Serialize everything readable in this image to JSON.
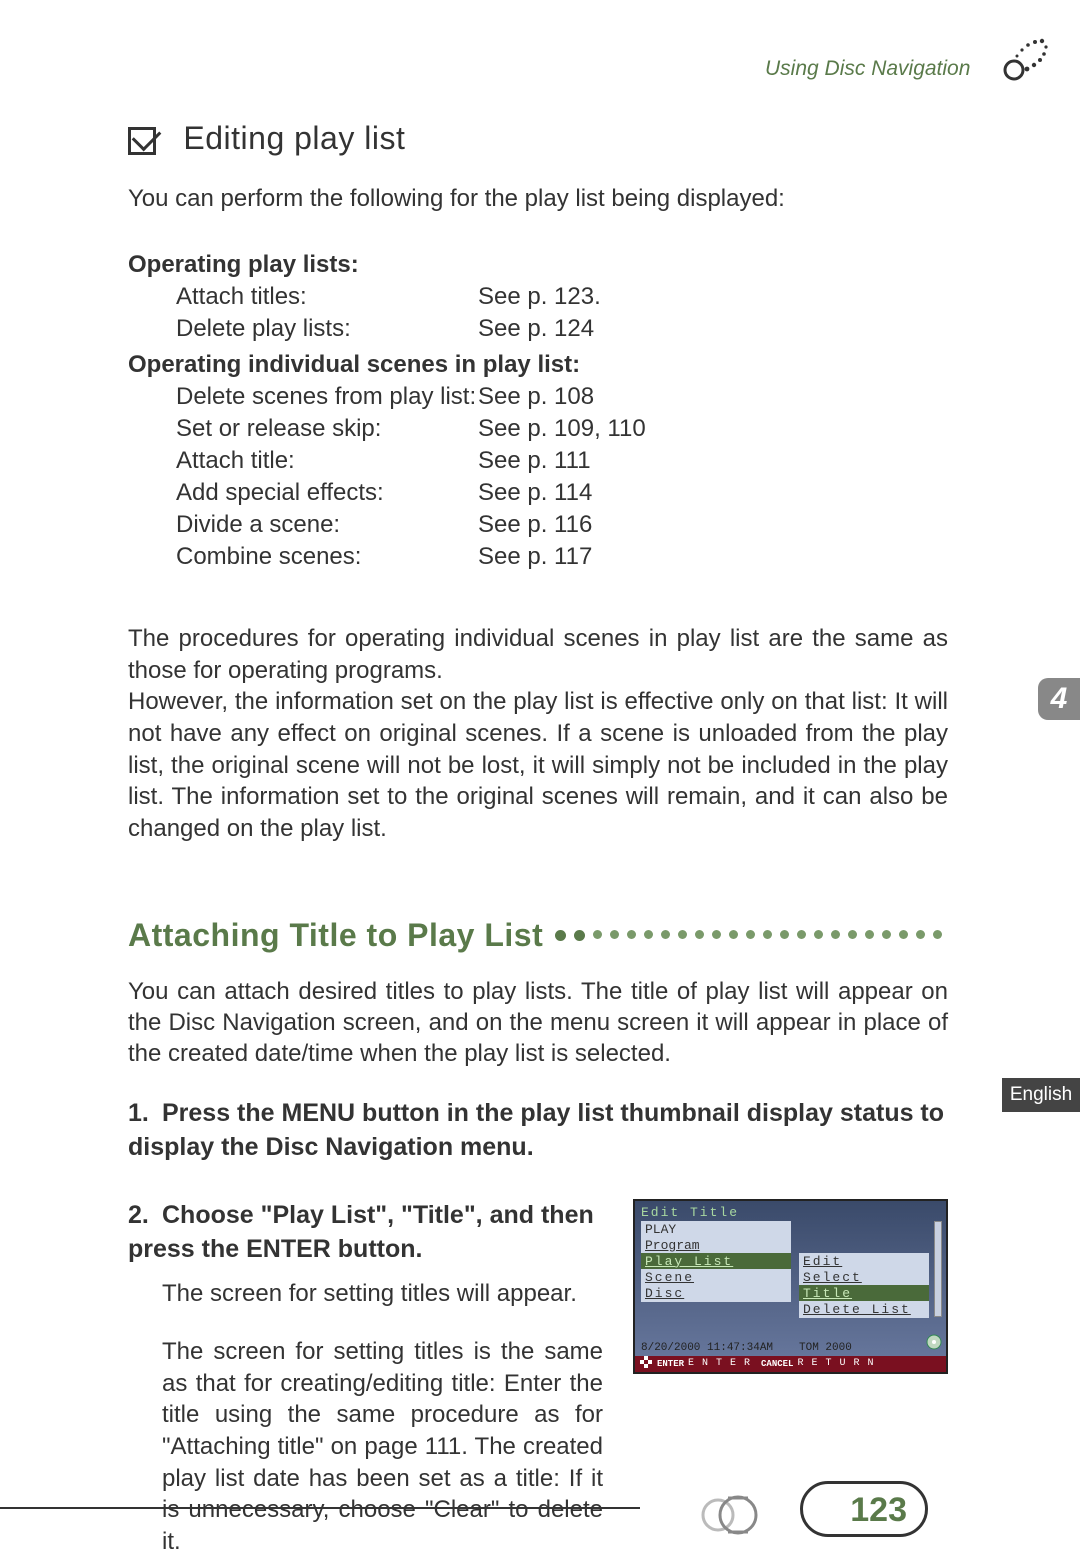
{
  "header": {
    "section": "Using Disc Navigation"
  },
  "title_block": {
    "heading": "Editing play list",
    "intro": "You can perform the following for the play list being displayed:"
  },
  "play_list_ops": {
    "heading": "Operating play lists:",
    "rows": [
      {
        "label": "Attach titles:",
        "ref": "See p. 123."
      },
      {
        "label": "Delete play lists:",
        "ref": "See p. 124"
      }
    ]
  },
  "scene_ops": {
    "heading": "Operating individual scenes in play list:",
    "rows": [
      {
        "label": "Delete scenes from play list:",
        "ref": "See p. 108"
      },
      {
        "label": "Set or release skip:",
        "ref": "See p. 109, 110"
      },
      {
        "label": "Attach title:",
        "ref": "See p. 111"
      },
      {
        "label": "Add special effects:",
        "ref": "See p. 114"
      },
      {
        "label": "Divide a scene:",
        "ref": "See p. 116"
      },
      {
        "label": "Combine scenes:",
        "ref": "See p. 117"
      }
    ]
  },
  "explain": {
    "p1": "The procedures for operating individual scenes in play list are the same as those for operating programs.",
    "p2": "However, the information set on the play list is effective only on that list: It will not have any effect on original scenes. If a scene is unloaded from the play list, the original scene will not be lost, it will simply not be included in the play list. The information set to the original scenes will remain, and it can also be changed on the play list."
  },
  "attach": {
    "heading": "Attaching Title to Play List",
    "intro": "You can attach desired titles to play lists. The title of play list will appear on the Disc Navigation screen, and on the menu screen it will appear in place of the created date/time when the play list is selected.",
    "step1": "Press the MENU button in the play list thumbnail display status to display the Disc Navigation menu.",
    "step2": "Choose \"Play List\", \"Title\", and then press the ENTER button.",
    "step2_note1": "The screen for setting titles will appear.",
    "step2_note2": "The screen for setting titles is the same as that for creating/editing title: Enter the title using the same procedure as for \"Attaching title\" on page 111. The created play list date has been set as a title: If it is unnecessary, choose \"Clear\" to delete it."
  },
  "screenshot": {
    "title": "Edit Title",
    "menu": [
      "PLAY",
      "Program",
      "Play List",
      "Scene",
      "Disc"
    ],
    "submenu": [
      "Edit",
      "Select",
      "Title",
      "Delete List"
    ],
    "datetime": "8/20/2000 11:47:34AM",
    "titleval": "TOM 2000",
    "bar": {
      "enter": "ENTER",
      "enter_lbl": "E N T E R",
      "cancel": "CANCEL",
      "cancel_lbl": "R E T U R N"
    }
  },
  "side": {
    "chapter": "4",
    "lang": "English"
  },
  "footer": {
    "page": "123"
  }
}
